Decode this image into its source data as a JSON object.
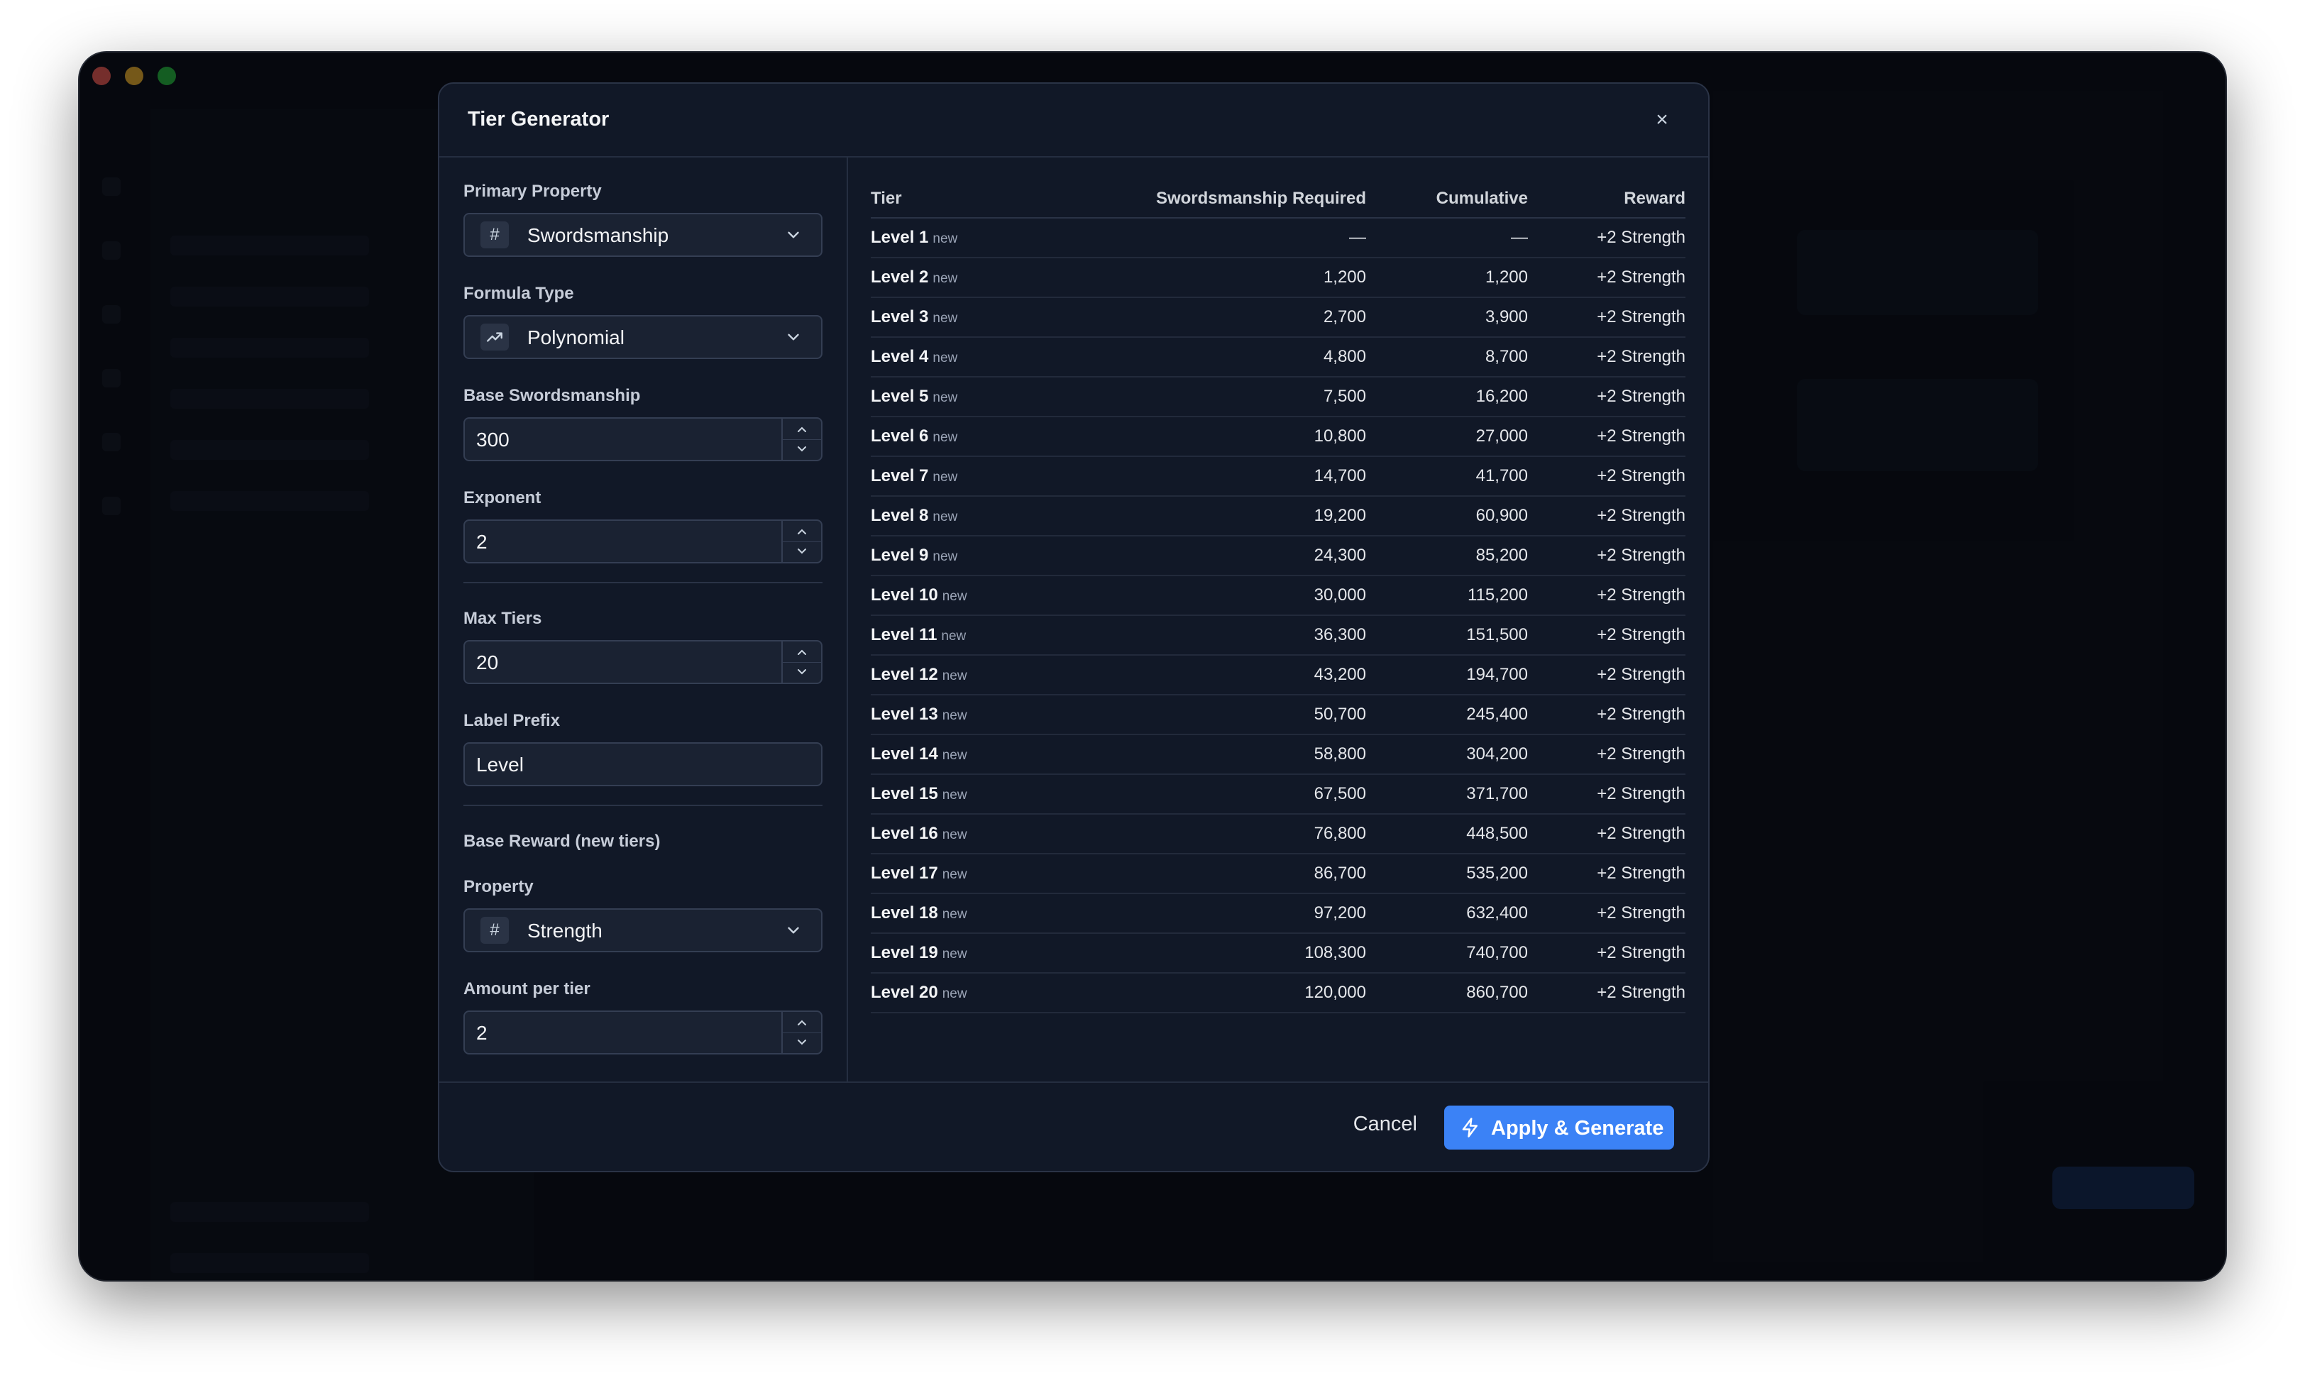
{
  "window": {
    "title": ""
  },
  "modal": {
    "title": "Tier Generator",
    "close_icon": "×"
  },
  "form": {
    "primary_property": {
      "label": "Primary Property",
      "value": "Swordsmanship",
      "icon": "#"
    },
    "formula_type": {
      "label": "Formula Type",
      "value": "Polynomial",
      "icon": "trending-up-icon"
    },
    "base": {
      "label": "Base Swordsmanship",
      "value": "300"
    },
    "exponent": {
      "label": "Exponent",
      "value": "2"
    },
    "max_tiers": {
      "label": "Max Tiers",
      "value": "20"
    },
    "label_prefix": {
      "label": "Label Prefix",
      "value": "Level"
    },
    "base_reward": {
      "section_label": "Base Reward (new tiers)"
    },
    "reward_property": {
      "label": "Property",
      "value": "Strength",
      "icon": "#"
    },
    "amount_per_tier": {
      "label": "Amount per tier",
      "value": "2"
    }
  },
  "table": {
    "headers": {
      "tier": "Tier",
      "required": "Swordsmanship Required",
      "cumulative": "Cumulative",
      "reward": "Reward"
    },
    "new_tag": "new",
    "rows": [
      {
        "tier": "Level 1",
        "required": "—",
        "cumulative": "—",
        "reward": "+2 Strength"
      },
      {
        "tier": "Level 2",
        "required": "1,200",
        "cumulative": "1,200",
        "reward": "+2 Strength"
      },
      {
        "tier": "Level 3",
        "required": "2,700",
        "cumulative": "3,900",
        "reward": "+2 Strength"
      },
      {
        "tier": "Level 4",
        "required": "4,800",
        "cumulative": "8,700",
        "reward": "+2 Strength"
      },
      {
        "tier": "Level 5",
        "required": "7,500",
        "cumulative": "16,200",
        "reward": "+2 Strength"
      },
      {
        "tier": "Level 6",
        "required": "10,800",
        "cumulative": "27,000",
        "reward": "+2 Strength"
      },
      {
        "tier": "Level 7",
        "required": "14,700",
        "cumulative": "41,700",
        "reward": "+2 Strength"
      },
      {
        "tier": "Level 8",
        "required": "19,200",
        "cumulative": "60,900",
        "reward": "+2 Strength"
      },
      {
        "tier": "Level 9",
        "required": "24,300",
        "cumulative": "85,200",
        "reward": "+2 Strength"
      },
      {
        "tier": "Level 10",
        "required": "30,000",
        "cumulative": "115,200",
        "reward": "+2 Strength"
      },
      {
        "tier": "Level 11",
        "required": "36,300",
        "cumulative": "151,500",
        "reward": "+2 Strength"
      },
      {
        "tier": "Level 12",
        "required": "43,200",
        "cumulative": "194,700",
        "reward": "+2 Strength"
      },
      {
        "tier": "Level 13",
        "required": "50,700",
        "cumulative": "245,400",
        "reward": "+2 Strength"
      },
      {
        "tier": "Level 14",
        "required": "58,800",
        "cumulative": "304,200",
        "reward": "+2 Strength"
      },
      {
        "tier": "Level 15",
        "required": "67,500",
        "cumulative": "371,700",
        "reward": "+2 Strength"
      },
      {
        "tier": "Level 16",
        "required": "76,800",
        "cumulative": "448,500",
        "reward": "+2 Strength"
      },
      {
        "tier": "Level 17",
        "required": "86,700",
        "cumulative": "535,200",
        "reward": "+2 Strength"
      },
      {
        "tier": "Level 18",
        "required": "97,200",
        "cumulative": "632,400",
        "reward": "+2 Strength"
      },
      {
        "tier": "Level 19",
        "required": "108,300",
        "cumulative": "740,700",
        "reward": "+2 Strength"
      },
      {
        "tier": "Level 20",
        "required": "120,000",
        "cumulative": "860,700",
        "reward": "+2 Strength"
      }
    ]
  },
  "footer": {
    "cancel_label": "Cancel",
    "apply_label": "Apply & Generate",
    "apply_icon": "lightning-icon"
  },
  "colors": {
    "accent": "#3b82f6",
    "reward_link": "#5b8def",
    "modal_bg": "#111827"
  }
}
